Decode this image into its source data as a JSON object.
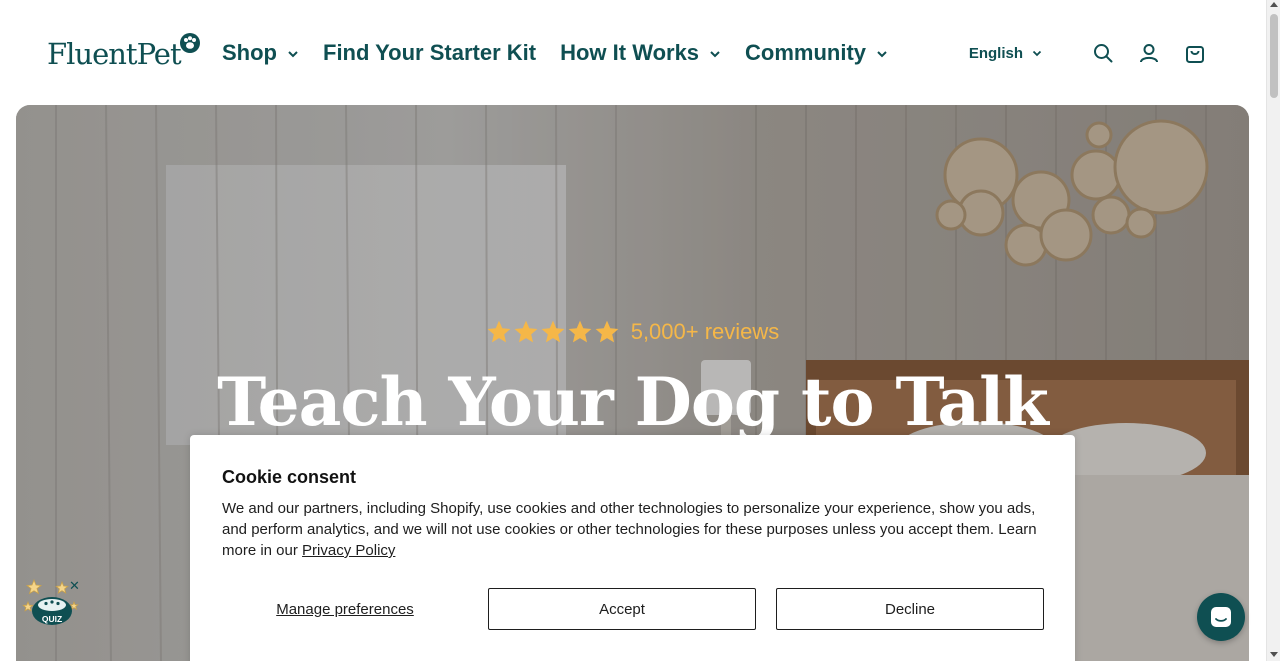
{
  "header": {
    "logo_text": "FluentPet",
    "nav": [
      {
        "label": "Shop",
        "has_dropdown": true
      },
      {
        "label": "Find Your Starter Kit",
        "has_dropdown": false
      },
      {
        "label": "How It Works",
        "has_dropdown": true
      },
      {
        "label": "Community",
        "has_dropdown": true
      }
    ],
    "language": "English",
    "icons": [
      "search-icon",
      "account-icon",
      "cart-icon"
    ]
  },
  "hero": {
    "rating_stars": 5,
    "reviews_text": "5,000+ reviews",
    "title": "Teach Your Dog to Talk"
  },
  "cookie": {
    "title": "Cookie consent",
    "body": "We and our partners, including Shopify, use cookies and other technologies to personalize your experience, show you ads, and perform analytics, and we will not use cookies or other technologies for these purposes unless you accept them. Learn more in our ",
    "privacy_link": "Privacy Policy",
    "manage_label": "Manage preferences",
    "accept_label": "Accept",
    "decline_label": "Decline"
  },
  "quiz": {
    "label": "QUIZ",
    "close": "✕"
  },
  "colors": {
    "brand": "#0f4f52",
    "star": "#f5b748",
    "hero_text": "#ffffff"
  }
}
